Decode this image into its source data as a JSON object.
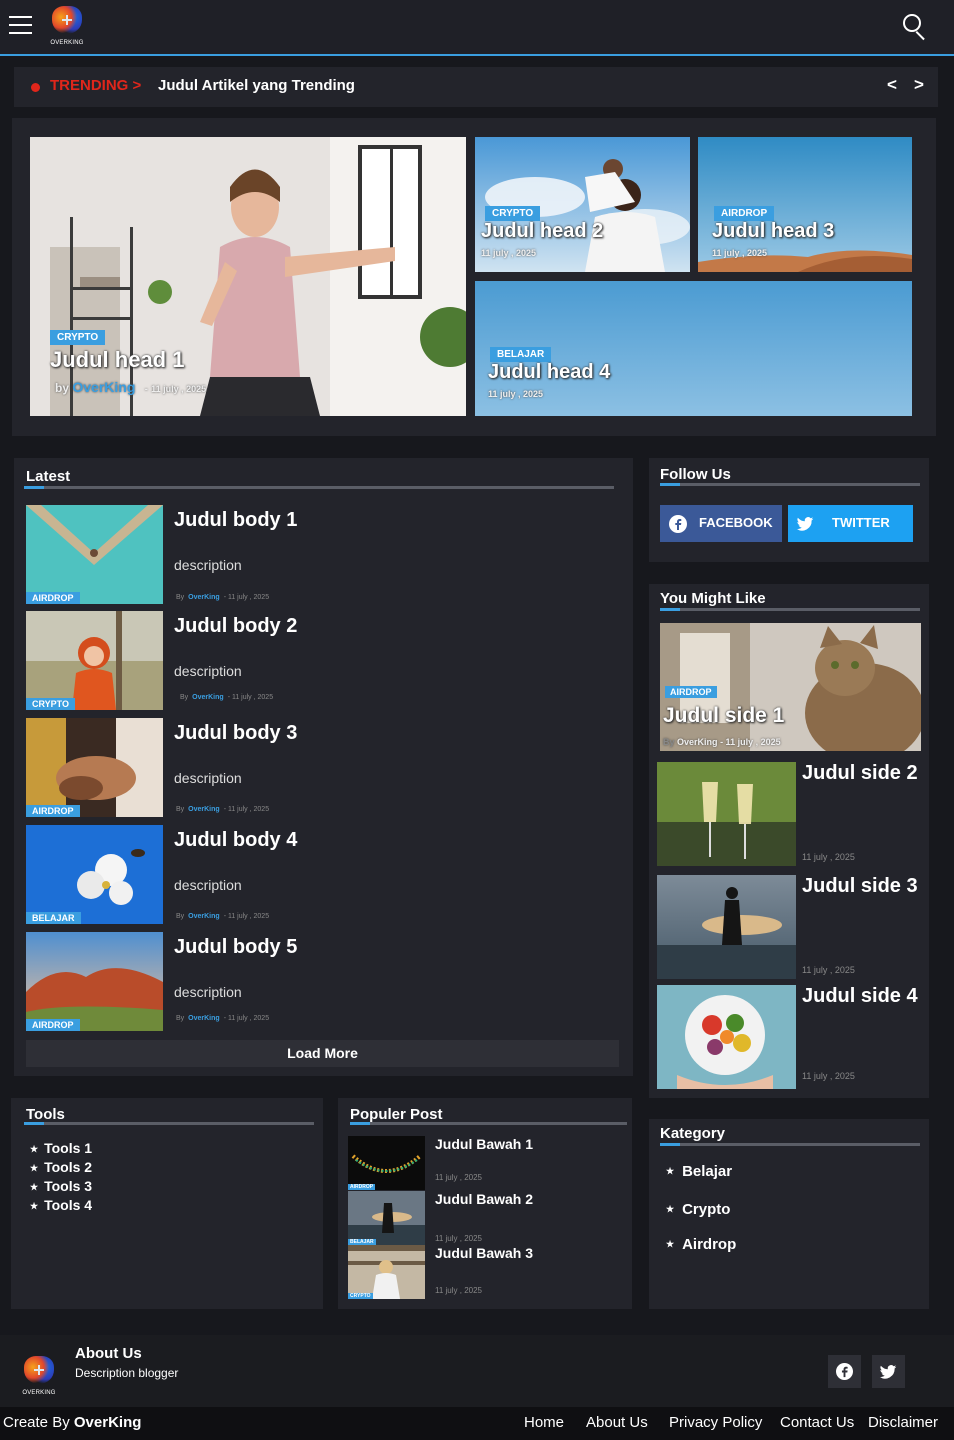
{
  "header": {
    "logo_text": "OVERKING",
    "menu_icon": "hamburger-icon",
    "search_icon": "search-icon"
  },
  "trending": {
    "label": "TRENDING >",
    "title": "Judul Artikel yang Trending",
    "prev": "<",
    "next": ">"
  },
  "heads": [
    {
      "tag": "CRYPTO",
      "title": "Judul head 1",
      "by": "by",
      "author": "OverKing",
      "sep": "-",
      "date": "11 july , 2025"
    },
    {
      "tag": "CRYPTO",
      "title": "Judul head 2",
      "date": "11 july , 2025"
    },
    {
      "tag": "AIRDROP",
      "title": "Judul head 3",
      "date": "11 july , 2025"
    },
    {
      "tag": "BELAJAR",
      "title": "Judul head 4",
      "date": "11 july , 2025"
    }
  ],
  "latest": {
    "title": "Latest",
    "items": [
      {
        "tag": "AIRDROP",
        "title": "Judul body 1",
        "desc": "description",
        "by": "By",
        "author": "OverKing",
        "date": "- 11 july , 2025"
      },
      {
        "tag": "CRYPTO",
        "title": "Judul body 2",
        "desc": "description",
        "by": "By",
        "author": "OverKing",
        "date": "- 11 july , 2025"
      },
      {
        "tag": "AIRDROP",
        "title": "Judul body 3",
        "desc": "description",
        "by": "By",
        "author": "OverKing",
        "date": "- 11 july , 2025"
      },
      {
        "tag": "BELAJAR",
        "title": "Judul body 4",
        "desc": "description",
        "by": "By",
        "author": "OverKing",
        "date": "- 11 july , 2025"
      },
      {
        "tag": "AIRDROP",
        "title": "Judul body 5",
        "desc": "description",
        "by": "By",
        "author": "OverKing",
        "date": "- 11 july , 2025"
      }
    ],
    "load_more": "Load More"
  },
  "follow": {
    "title": "Follow Us",
    "facebook": "FACEBOOK",
    "twitter": "TWITTER",
    "facebook_color": "#3b5998",
    "twitter_color": "#1da1f2"
  },
  "might_like": {
    "title": "You Might Like",
    "featured": {
      "tag": "AIRDROP",
      "title": "Judul side 1",
      "by": "By",
      "author": "OverKing",
      "date": "- 11 july , 2025"
    },
    "items": [
      {
        "title": "Judul side 2",
        "date": "11 july , 2025"
      },
      {
        "title": "Judul side 3",
        "date": "11 july , 2025"
      },
      {
        "title": "Judul side 4",
        "date": "11 july , 2025"
      }
    ]
  },
  "tools": {
    "title": "Tools",
    "items": [
      "Tools 1",
      "Tools 2",
      "Tools 3",
      "Tools 4"
    ]
  },
  "populer": {
    "title": "Populer Post",
    "items": [
      {
        "tag": "AIRDROP",
        "title": "Judul Bawah 1",
        "date": "11 july , 2025"
      },
      {
        "tag": "BELAJAR",
        "title": "Judul Bawah 2",
        "date": "11 july , 2025"
      },
      {
        "tag": "CRYPTO",
        "title": "Judul Bawah 3",
        "date": "11 july , 2025"
      }
    ]
  },
  "kategory": {
    "title": "Kategory",
    "items": [
      "Belajar",
      "Crypto",
      "Airdrop"
    ]
  },
  "footer": {
    "about_title": "About Us",
    "about_desc": "Description blogger",
    "create_by": "Create By",
    "brand": "OverKing",
    "links": [
      "Home",
      "About Us",
      "Privacy Policy",
      "Contact Us",
      "Disclaimer"
    ]
  },
  "colors": {
    "accent": "#3a9ee0",
    "trending": "#e0261b",
    "bg": "#17181d",
    "panel": "#23242b"
  }
}
